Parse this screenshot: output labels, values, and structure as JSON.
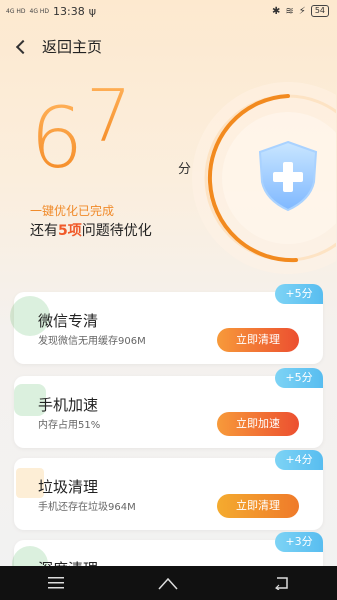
{
  "status": {
    "signal1": "4G HD",
    "signal2": "4G HD",
    "time": "13:38",
    "battery": "54"
  },
  "header": {
    "back_label": "返回主页"
  },
  "score": {
    "digit1": "6",
    "digit2": "7",
    "unit": "分",
    "done_text": "一键优化已完成",
    "remain_prefix": "还有",
    "remain_count": "5项",
    "remain_suffix": "问题待优化"
  },
  "cards": [
    {
      "title": "微信专清",
      "desc": "发现微信无用缓存906M",
      "button": "立即清理",
      "badge": "+5分"
    },
    {
      "title": "手机加速",
      "desc": "内存占用51%",
      "button": "立即加速",
      "badge": "+5分"
    },
    {
      "title": "垃圾清理",
      "desc": "手机还存在垃圾964M",
      "button": "立即清理",
      "badge": "+4分"
    },
    {
      "title": "深度清理",
      "desc": "",
      "button": "",
      "badge": "+3分"
    }
  ],
  "colors": {
    "accent": "#f48a25",
    "highlight": "#f05a2a",
    "badge": "#58bdf0"
  },
  "icons": [
    "back-icon",
    "shield-plus-icon",
    "wechat-icon",
    "rocket-icon",
    "trash-icon",
    "deep-clean-icon",
    "menu-icon",
    "home-icon",
    "back-nav-icon"
  ]
}
